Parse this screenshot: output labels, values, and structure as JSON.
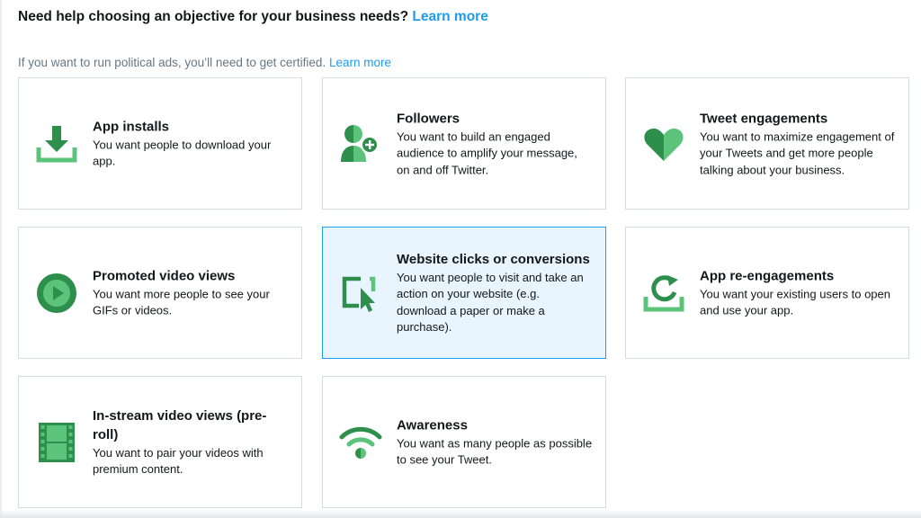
{
  "header": {
    "help_text": "Need help choosing an objective for your business needs?",
    "help_link": "Learn more",
    "political_text": "If you want to run political ads, you’ll need to get certified.",
    "political_link": "Learn more"
  },
  "colors": {
    "link": "#1d9bf0",
    "icon_green_dark": "#2e8f4c",
    "icon_green_light": "#5cc37a",
    "selected_bg": "#e8f5fe",
    "selected_border": "#1da1f2"
  },
  "objectives": [
    {
      "icon": "download-icon",
      "title": "App installs",
      "description": "You want people to download your app.",
      "selected": false
    },
    {
      "icon": "add-follower-icon",
      "title": "Followers",
      "description": "You want to build an engaged audience to amplify your message, on and off Twitter.",
      "selected": false
    },
    {
      "icon": "heart-icon",
      "title": "Tweet engagements",
      "description": "You want to maximize engagement of your Tweets and get more people talking about your business.",
      "selected": false
    },
    {
      "icon": "play-icon",
      "title": "Promoted video views",
      "description": "You want more people to see your GIFs or videos.",
      "selected": false
    },
    {
      "icon": "cursor-click-icon",
      "title": "Website clicks or conversions",
      "description": "You want people to visit and take an action on your website (e.g. download a paper or make a purchase).",
      "selected": true
    },
    {
      "icon": "refresh-icon",
      "title": "App re-engagements",
      "description": "You want your existing users to open and use your app.",
      "selected": false
    },
    {
      "icon": "film-strip-icon",
      "title": "In-stream video views (pre-roll)",
      "description": "You want to pair your videos with premium content.",
      "selected": false
    },
    {
      "icon": "broadcast-icon",
      "title": "Awareness",
      "description": "You want as many people as possible to see your Tweet.",
      "selected": false
    }
  ]
}
